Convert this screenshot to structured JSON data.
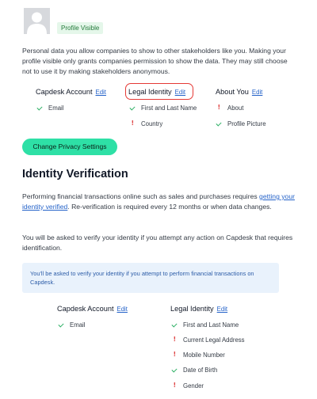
{
  "profile": {
    "badge": "Profile Visible",
    "intro": "Personal data you allow companies to show to other stakeholders like you. Making your profile visible only grants companies permission to show the data. They may still choose not to use it by making stakeholders anonymous."
  },
  "privacy_columns": [
    {
      "title": "Capdesk Account",
      "edit": "Edit",
      "items": [
        {
          "label": "Email",
          "status": "ok"
        }
      ]
    },
    {
      "title": "Legal Identity",
      "edit": "Edit",
      "items": [
        {
          "label": "First and Last Name",
          "status": "ok"
        },
        {
          "label": "Country",
          "status": "warn"
        }
      ]
    },
    {
      "title": "About You",
      "edit": "Edit",
      "items": [
        {
          "label": "About",
          "status": "warn"
        },
        {
          "label": "Profile Picture",
          "status": "ok"
        }
      ]
    }
  ],
  "privacy_button": "Change Privacy Settings",
  "verification": {
    "title": "Identity Verification",
    "para1_before": "Performing financial transactions online such as sales and purchases requires ",
    "para1_link": "getting your identity verified",
    "para1_after": ". Re-verification is required every 12 months or when data changes.",
    "para2": "You will be asked to verify your identity if you attempt any action on Capdesk that requires identification.",
    "info": "You'll be asked to verify your identity if you attempt to perform financial transactions on Capdesk.",
    "columns": [
      {
        "title": "Capdesk Account",
        "edit": "Edit",
        "items": [
          {
            "label": "Email",
            "status": "ok"
          }
        ]
      },
      {
        "title": "Legal Identity",
        "edit": "Edit",
        "items": [
          {
            "label": "First and Last Name",
            "status": "ok"
          },
          {
            "label": "Current Legal Address",
            "status": "warn"
          },
          {
            "label": "Mobile Number",
            "status": "warn"
          },
          {
            "label": "Date of Birth",
            "status": "ok"
          },
          {
            "label": "Gender",
            "status": "warn"
          }
        ]
      }
    ]
  },
  "colors": {
    "accent": "#2ee0a6",
    "link": "#2563c9",
    "ok": "#27ae60",
    "warn": "#e04848",
    "info_bg": "#e9f2fc"
  },
  "icons": {
    "ok": "check-icon",
    "warn": "exclamation-icon",
    "avatar": "user-silhouette-icon"
  }
}
